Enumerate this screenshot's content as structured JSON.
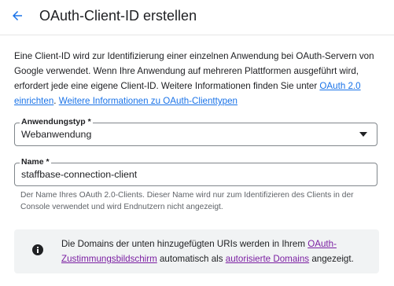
{
  "header": {
    "title": "OAuth-Client-ID erstellen"
  },
  "description": {
    "text_before": "Eine Client-ID wird zur Identifizierung einer einzelnen Anwendung bei OAuth-Servern von Google verwendet. Wenn Ihre Anwendung auf mehreren Plattformen ausgeführt wird, erfordert jede eine eigene Client-ID. Weitere Informationen finden Sie unter ",
    "link1": "OAuth 2.0 einrichten",
    "separator": ". ",
    "link2": "Weitere Informationen zu OAuth-Clienttypen"
  },
  "app_type": {
    "label": "Anwendungstyp *",
    "value": "Webanwendung"
  },
  "name": {
    "label": "Name *",
    "value": "staffbase-connection-client",
    "hint": "Der Name Ihres OAuth 2.0-Clients. Dieser Name wird nur zum Identifizieren des Clients in der Console verwendet und wird Endnutzern nicht angezeigt."
  },
  "info": {
    "text1": "Die Domains der unten hinzugefügten URIs werden in Ihrem ",
    "link1": "OAuth-Zustimmungsbildschirm",
    "text2": " automatisch als ",
    "link2": "autorisierte Domains",
    "text3": " angezeigt."
  },
  "colors": {
    "accent": "#1a73e8",
    "visited_link": "#7b1fa2",
    "info_bg": "#f1f3f4"
  },
  "icons": {
    "back": "arrow-left-icon",
    "dropdown": "caret-down-icon",
    "info": "info-circle-icon"
  }
}
